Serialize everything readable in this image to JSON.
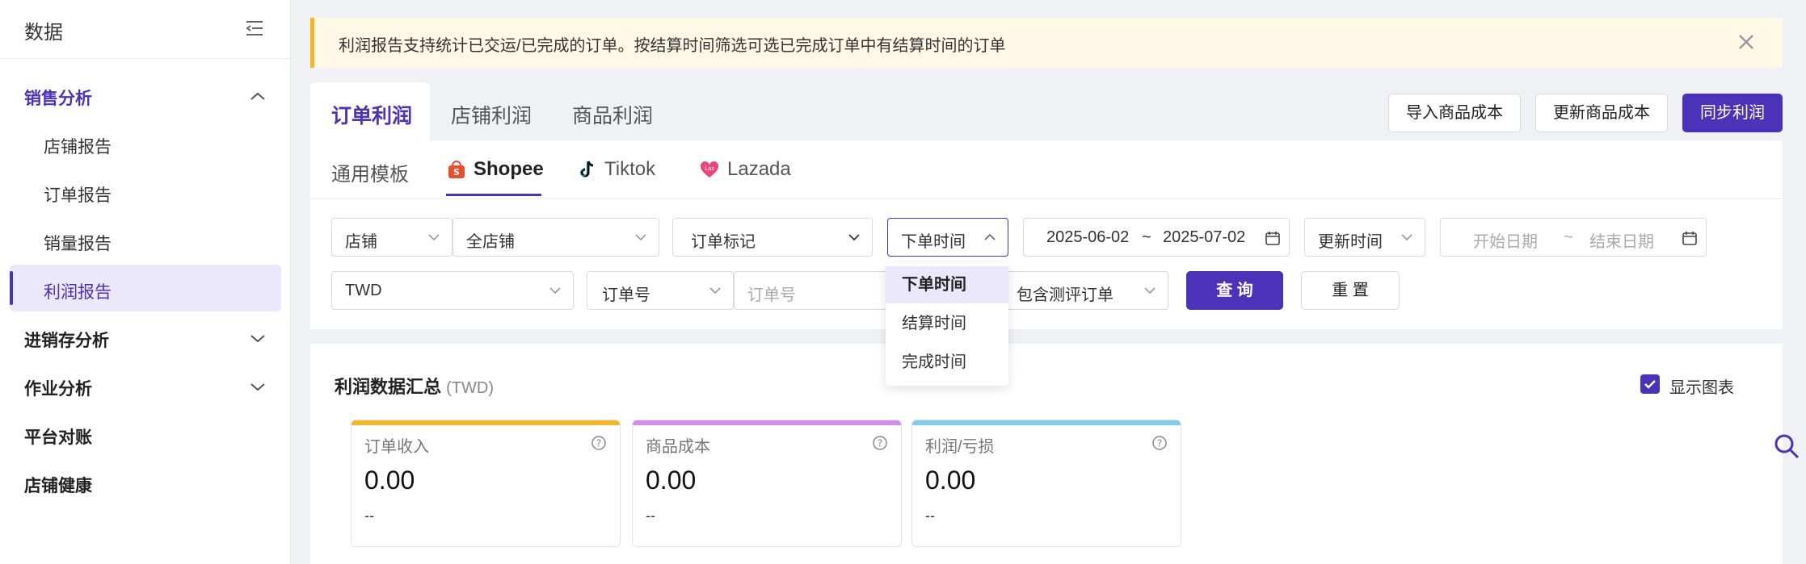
{
  "sidebar": {
    "title": "数据",
    "groups": [
      {
        "label": "销售分析",
        "expanded": true
      },
      {
        "label": "进销存分析"
      },
      {
        "label": "作业分析"
      },
      {
        "label": "平台对账"
      },
      {
        "label": "店铺健康"
      }
    ],
    "items": [
      {
        "label": "店铺报告"
      },
      {
        "label": "订单报告"
      },
      {
        "label": "销量报告"
      },
      {
        "label": "利润报告",
        "active": true
      }
    ]
  },
  "notice": {
    "text": "利润报告支持统计已交运/已完成的订单。按结算时间筛选可选已完成订单中有结算时间的订单"
  },
  "tabs": [
    {
      "label": "订单利润",
      "active": true
    },
    {
      "label": "店铺利润"
    },
    {
      "label": "商品利润"
    }
  ],
  "actions": {
    "import_cost": "导入商品成本",
    "update_cost": "更新商品成本",
    "sync_profit": "同步利润"
  },
  "platform_tabs": [
    {
      "label": "通用模板"
    },
    {
      "label": "Shopee",
      "active": true,
      "icon": "shopee-icon"
    },
    {
      "label": "Tiktok",
      "icon": "tiktok-icon"
    },
    {
      "label": "Lazada",
      "icon": "lazada-icon"
    }
  ],
  "filters": {
    "shop_type": "店铺",
    "shop_value": "全店铺",
    "order_tag": "订单标记",
    "time_type": "下单时间",
    "date_start": "2025-06-02",
    "date_sep": "~",
    "date_end": "2025-07-02",
    "update_time": "更新时间",
    "start_placeholder": "开始日期",
    "end_placeholder": "结束日期",
    "currency": "TWD",
    "order_no_type": "订单号",
    "order_no_placeholder": "订单号",
    "review_order": "包含测评订单",
    "query": "查 询",
    "reset": "重 置"
  },
  "time_dropdown": {
    "options": [
      "下单时间",
      "结算时间",
      "完成时间"
    ],
    "selected": "下单时间"
  },
  "summary": {
    "title": "利润数据汇总",
    "unit": "(TWD)",
    "show_chart_label": "显示图表",
    "show_chart_checked": true,
    "cards": [
      {
        "title": "订单收入",
        "value": "0.00",
        "sub": "--",
        "color": "#f5b623"
      },
      {
        "title": "商品成本",
        "value": "0.00",
        "sub": "--",
        "color": "#d48cf0"
      },
      {
        "title": "利润/亏损",
        "value": "0.00",
        "sub": "--",
        "color": "#7ccdee"
      }
    ]
  },
  "colors": {
    "accent": "#4a33b8",
    "notice_bg": "#fff8e6",
    "notice_border": "#f5b623"
  }
}
